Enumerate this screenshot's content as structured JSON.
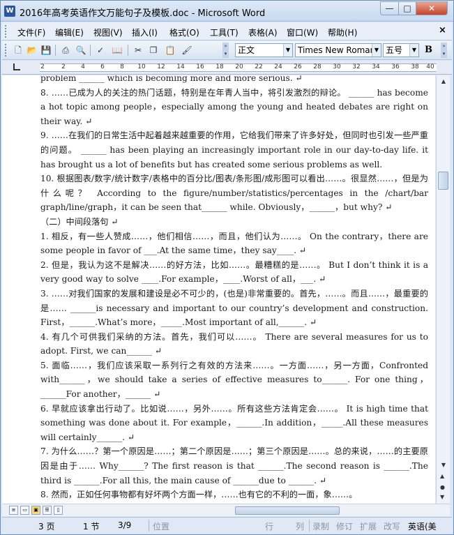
{
  "window": {
    "title": "2016年高考英语作文万能句子及模板.doc - Microsoft Word",
    "app_icon": "W",
    "controls": {
      "minimize": "—",
      "maximize": "□",
      "close": "✕"
    }
  },
  "menu": {
    "items": [
      "文件(F)",
      "编辑(E)",
      "视图(V)",
      "插入(I)",
      "格式(O)",
      "工具(T)",
      "表格(A)",
      "窗口(W)",
      "帮助(H)"
    ],
    "close_doc": "×"
  },
  "toolbar": {
    "icons": [
      "new-doc-icon",
      "open-icon",
      "save-icon",
      "print-icon",
      "print-preview-icon",
      "spellcheck-icon",
      "research-icon",
      "cut-icon",
      "copy-icon",
      "paste-icon",
      "format-painter-icon"
    ],
    "style_value": "正文",
    "font_value": "Times New Roman",
    "size_value": "五号",
    "bold_label": "B"
  },
  "ruler": {
    "ticks": [
      "2",
      "2",
      "4",
      "6",
      "8",
      "10",
      "12",
      "14",
      "16",
      "18",
      "20",
      "22",
      "24",
      "26",
      "28",
      "30",
      "32",
      "34",
      "36",
      "38",
      "40"
    ]
  },
  "document": {
    "paragraphs": [
      "problem ______ which is becoming more and more serious. ↵",
      "  8. ……已成为人的关注的热门话题，特别是在年青人当中，将引发激烈的辩论。 ______ has become a hot topic among people，especially among the young and heated debates are right on their way. ↵",
      "  9. ……在我们的日常生活中起着越来越重要的作用，它给我们带来了许多好处，但同时也引发一些严重的问题。 ______ has been playing an increasingly important role in our day-to-day life. it has brought us a lot of benefits but has created some serious problems as well.",
      "10. 根据图表/数字/统计数字/表格中的百分比/图表/条形图/成形图可以看出……。很显然……，但是为什么呢？ According to the figure/number/statistics/percentages in the /chart/bar graph/line/graph，it can be seen that______ while. Obviously，______，but why? ↵",
      "（二）中间段落句 ↵",
      "1. 相反，有一些人赞成……，他们相信……，而且，他们认为……。 On the contrary，there are some people in favor of ___.At the same time，they say____. ↵",
      "  2. 但是，我认为这不是解决……的好方法，比如……。最糟糕的是……。 But I don’t think it is a very good way to solve ____.For example，____.Worst of all，___. ↵",
      "  3. ……对我们国家的发展和建设是必不可少的，(也是)非常重要的。首先，……。而且……，最重要的是……  ______is necessary and important to our country’s development and construction. First，______.What’s more，_____.Most important of all,______. ↵",
      "  4. 有几个可供我们采纳的方法。首先，我们可以……。 There are several measures for us to adopt. First, we can______ ↵",
      "5. 面临……，我们应该采取一系列行之有效的方法来……。一方面……，另一方面，Confronted with______，we should take a series of effective measures to______. For one thing，______For another，______ ↵",
      "  6. 早就应该拿出行动了。比如说……，另外……。所有这些方法肯定会……。 It is high time that something was done about it. For example，______.In addition，_____.All these measures will certainly______. ↵",
      "7. 为什么……？第一个原因是……；第二个原因是……；第三个原因是……。总的来说，……的主要原因是由于……  Why______? The first reason is that ______.The second reason is ______.The third is ______.For all this, the main cause of ______due to ______. ↵",
      "  8. 然而，正如任何事物都有好坏两个方面一样，……也有它的不利的一面，象……。"
    ]
  },
  "statusbar": {
    "page": "3 页",
    "section": "1 节",
    "page_of": "3/9",
    "position_label": "位置",
    "line_label": "行",
    "col_label": "列",
    "rec": "录制",
    "trk": "修订",
    "ext": "扩展",
    "ovr": "改写",
    "language": "英语(美"
  }
}
